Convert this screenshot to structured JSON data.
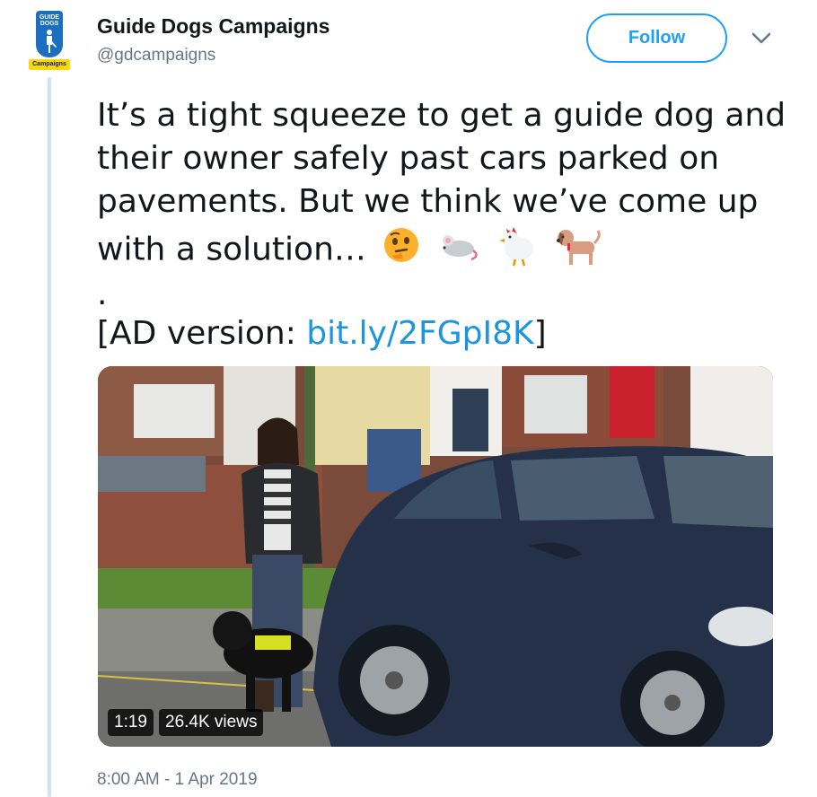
{
  "account": {
    "avatar": {
      "top_text": "GUIDE DOGS",
      "tag_text": "Campaigns",
      "brand_color": "#1a6fc0",
      "tag_color": "#f5d90a"
    },
    "name": "Guide Dogs Campaigns",
    "handle": "@gdcampaigns"
  },
  "actions": {
    "follow_label": "Follow",
    "menu_icon": "chevron-down-icon"
  },
  "tweet": {
    "text": "It’s a tight squeeze to get a guide dog and their owner safely past cars parked on pavements. But we think we’ve come up with a solution…",
    "emojis": [
      "thinking-face",
      "mouse",
      "chicken",
      "dog"
    ],
    "dot": ".",
    "ad_prefix": "[AD version: ",
    "ad_link": "bit.ly/2FGpI8K",
    "ad_suffix": "]",
    "link_color": "#1b95e0"
  },
  "video": {
    "duration": "1:19",
    "views": "26.4K views"
  },
  "timestamp": "8:00 AM - 1 Apr 2019"
}
